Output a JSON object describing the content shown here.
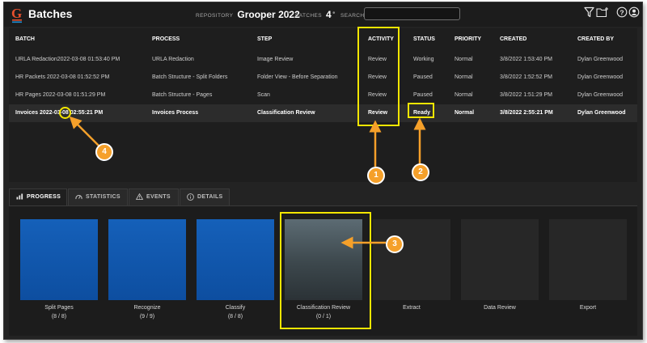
{
  "app": {
    "title": "Batches"
  },
  "header": {
    "repository_label": "REPOSITORY",
    "repository_value": "Grooper 2022",
    "batches_label": "BATCHES",
    "batches_value": "4",
    "search_label": "SEARCH",
    "search_value": "",
    "icons": [
      "filter-icon",
      "new-folder-icon",
      "help-icon",
      "user-icon"
    ]
  },
  "table": {
    "columns": [
      "BATCH",
      "PROCESS",
      "STEP",
      "ACTIVITY",
      "STATUS",
      "PRIORITY",
      "CREATED",
      "CREATED BY"
    ],
    "rows": [
      {
        "batch": "URLA Redaction2022-03-08 01:53:40 PM",
        "process": "URLA Redaction",
        "step": "Image Review",
        "activity": "Review",
        "status": "Working",
        "priority": "Normal",
        "created": "3/8/2022 1:53:40 PM",
        "created_by": "Dylan Greenwood"
      },
      {
        "batch": "HR Packets 2022-03-08 01:52:52 PM",
        "process": "Batch Structure - Split Folders",
        "step": "Folder View - Before Separation",
        "activity": "Review",
        "status": "Paused",
        "priority": "Normal",
        "created": "3/8/2022 1:52:52 PM",
        "created_by": "Dylan Greenwood"
      },
      {
        "batch": "HR Pages 2022-03-08 01:51:29 PM",
        "process": "Batch Structure - Pages",
        "step": "Scan",
        "activity": "Review",
        "status": "Paused",
        "priority": "Normal",
        "created": "3/8/2022 1:51:29 PM",
        "created_by": "Dylan Greenwood"
      },
      {
        "batch": "Invoices 2022-03-08 02:55:21 PM",
        "process": "Invoices Process",
        "step": "Classification Review",
        "activity": "Review",
        "status": "Ready",
        "priority": "Normal",
        "created": "3/8/2022 2:55:21 PM",
        "created_by": "Dylan Greenwood"
      }
    ],
    "selected_row": 3
  },
  "tabs": [
    {
      "label": "PROGRESS",
      "icon": "bar-chart-icon",
      "active": true
    },
    {
      "label": "STATISTICS",
      "icon": "gauge-icon",
      "active": false
    },
    {
      "label": "EVENTS",
      "icon": "warning-icon",
      "active": false
    },
    {
      "label": "DETAILS",
      "icon": "info-icon",
      "active": false
    }
  ],
  "steps": [
    {
      "name": "Split Pages",
      "count": "(8 / 8)",
      "state": "complete"
    },
    {
      "name": "Recognize",
      "count": "(9 / 9)",
      "state": "complete"
    },
    {
      "name": "Classify",
      "count": "(8 / 8)",
      "state": "complete"
    },
    {
      "name": "Classification Review",
      "count": "(0 / 1)",
      "state": "active"
    },
    {
      "name": "Extract",
      "count": "",
      "state": "pending"
    },
    {
      "name": "Data Review",
      "count": "",
      "state": "pending"
    },
    {
      "name": "Export",
      "count": "",
      "state": "pending"
    }
  ],
  "annotations": [
    {
      "number": "1",
      "target": "activity-column"
    },
    {
      "number": "2",
      "target": "ready-status"
    },
    {
      "number": "3",
      "target": "classification-review-tile"
    },
    {
      "number": "4",
      "target": "invoices-batch-name"
    }
  ],
  "colors": {
    "background": "#232323",
    "step_complete": "#1560b9",
    "step_active": "#5c6b73",
    "highlight": "#f3e600",
    "callout": "#f5a02a"
  }
}
